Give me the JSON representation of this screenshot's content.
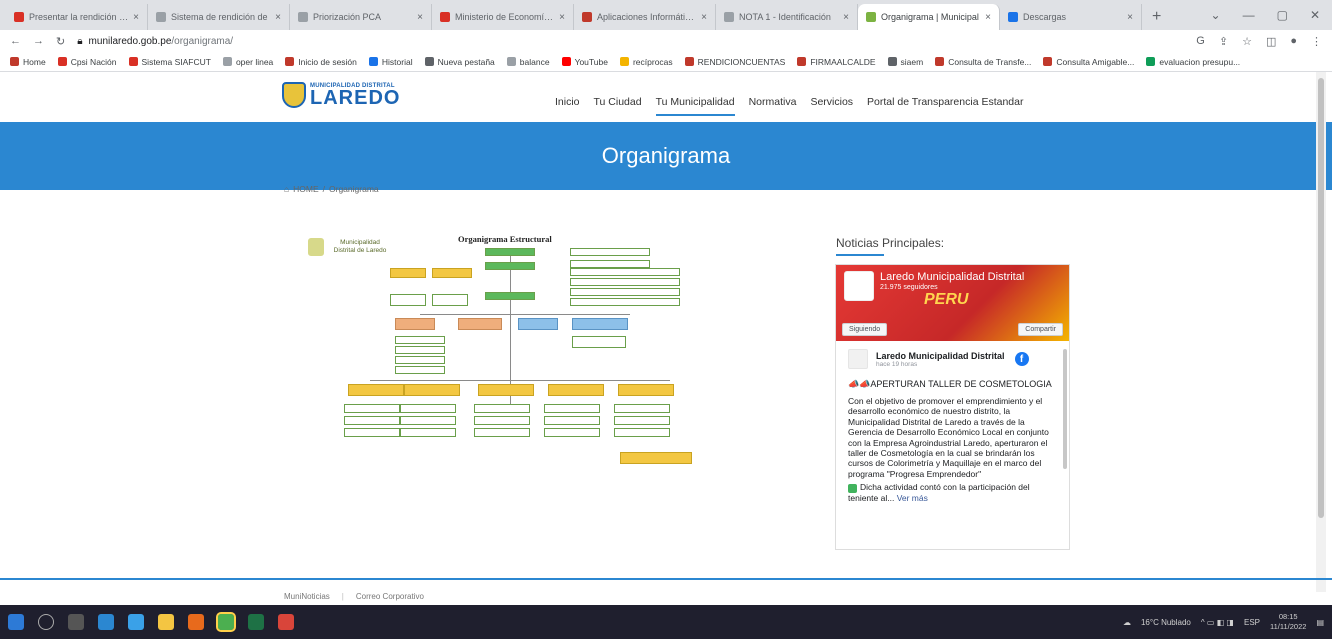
{
  "browser": {
    "tabs": [
      {
        "label": "Presentar la rendición de",
        "color": "#d93025",
        "active": false
      },
      {
        "label": "Sistema de rendición de",
        "color": "#9aa0a6",
        "active": false
      },
      {
        "label": "Priorización PCA",
        "color": "#9aa0a6",
        "active": false
      },
      {
        "label": "Ministerio de Economía y",
        "color": "#d93025",
        "active": false
      },
      {
        "label": "Aplicaciones Informáticas",
        "color": "#c0392b",
        "active": false
      },
      {
        "label": "NOTA 1 - Identificación",
        "color": "#9aa0a6",
        "active": false
      },
      {
        "label": "Organigrama | Municipal",
        "color": "#7cb342",
        "active": true
      },
      {
        "label": "Descargas",
        "color": "#1a73e8",
        "active": false
      }
    ],
    "new_tab": "+",
    "window_controls": [
      "⌄",
      "—",
      "▢",
      "✕"
    ],
    "url_host": "munilaredo.gob.pe",
    "url_path": "/organigrama/",
    "bookmarks": [
      {
        "label": "Home",
        "color": "#c0392b"
      },
      {
        "label": "Cpsi Nación",
        "color": "#d93025"
      },
      {
        "label": "Sistema SIAFCUT",
        "color": "#d93025"
      },
      {
        "label": "oper linea",
        "color": "#9aa0a6"
      },
      {
        "label": "Inicio de sesión",
        "color": "#c0392b"
      },
      {
        "label": "Historial",
        "color": "#1a73e8"
      },
      {
        "label": "Nueva pestaña",
        "color": "#5f6368"
      },
      {
        "label": "balance",
        "color": "#9aa0a6"
      },
      {
        "label": "YouTube",
        "color": "#ff0000"
      },
      {
        "label": "recíprocas",
        "color": "#f4b400"
      },
      {
        "label": "RENDICIONCUENTAS",
        "color": "#c0392b"
      },
      {
        "label": "FIRMAALCALDE",
        "color": "#c0392b"
      },
      {
        "label": "siaem",
        "color": "#5f6368"
      },
      {
        "label": "Consulta de Transfe...",
        "color": "#c0392b"
      },
      {
        "label": "Consulta Amigable...",
        "color": "#c0392b"
      },
      {
        "label": "evaluacion presupu...",
        "color": "#0f9d58"
      }
    ]
  },
  "site": {
    "logo_small": "MUNICIPALIDAD DISTRITAL",
    "logo_big": "LAREDO",
    "nav": [
      "Inicio",
      "Tu Ciudad",
      "Tu Municipalidad",
      "Normativa",
      "Servicios",
      "Portal de Transparencia Estandar"
    ],
    "nav_active_index": 2,
    "banner_title": "Organigrama",
    "breadcrumb": {
      "home": "HOME",
      "sep": "/",
      "current": "Organigrama"
    },
    "accent": "#2b87d1"
  },
  "organigram": {
    "logo_text": "Municipalidad Distrital de Laredo",
    "title": "Organigrama Estructural"
  },
  "news": {
    "title": "Noticias Principales:",
    "fb_page_name": "Laredo Municipalidad Distrital",
    "fb_followers": "21.975 seguidores",
    "fb_cover_text": "PERU",
    "follow_label": "Siguiendo",
    "share_label": "Compartir",
    "post_author": "Laredo Municipalidad Distrital",
    "post_time": "hace 19 horas",
    "post_headline": "📣📣APERTURAN TALLER DE COSMETOLOGIA",
    "post_body": "Con el objetivo de promover el emprendimiento y el desarrollo económico de nuestro distrito, la Municipalidad Distrital de Laredo a través de la Gerencia de Desarrollo Económico Local en conjunto con la Empresa Agroindustrial Laredo, aperturaron el taller de Cosmetología en la cual se brindarán los cursos de Colorimetría y Maquillaje en el marco del programa \"Progresa Emprendedor\"",
    "post_more": "Dicha actividad contó con la participación del teniente al...",
    "ver_mas": "Ver más"
  },
  "footer": {
    "links": [
      "MuniNoticias",
      "Correo Corporativo"
    ]
  },
  "taskbar": {
    "weather": "16°C Nublado",
    "lang": "ESP",
    "time": "08:15",
    "date": "11/11/2022"
  }
}
